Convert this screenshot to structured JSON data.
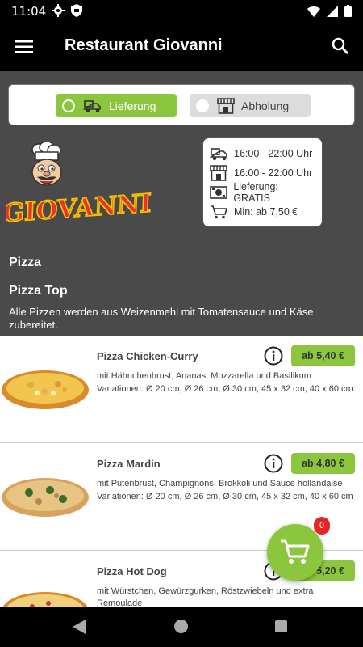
{
  "status": {
    "time": "11:04"
  },
  "app": {
    "title": "Restaurant Giovanni"
  },
  "mode": {
    "delivery_label": "Lieferung",
    "pickup_label": "Abholung"
  },
  "logo": {
    "text": "GIOVANNI"
  },
  "info": {
    "delivery_hours": "16:00 - 22:00 Uhr",
    "pickup_hours": "16:00 - 22:00 Uhr",
    "delivery_fee": "Lieferung: GRATIS",
    "min_order": "Min: ab 7,50 €"
  },
  "category": {
    "title": "Pizza",
    "subtitle": "Pizza Top",
    "description": "Alle Pizzen werden aus Weizenmehl mit Tomatensauce und Käse zubereitet."
  },
  "products": [
    {
      "name": "Pizza Chicken-Curry",
      "price": "ab 5,40 €",
      "desc": "mit Hähnchenbrust, Ananas, Mozzarella und Basilikum",
      "variations": "Variationen: Ø 20 cm, Ø 26 cm, Ø 30 cm, 45 x 32 cm, 40 x 60 cm"
    },
    {
      "name": "Pizza Mardin",
      "price": "ab 4,80 €",
      "desc": "mit Putenbrust, Champignons, Brokkoli und Sauce hollandaise",
      "variations": "Variationen: Ø 20 cm, Ø 26 cm, Ø 30 cm, 45 x 32 cm, 40 x 60 cm"
    },
    {
      "name": "Pizza Hot Dog",
      "price": "ab 5,20 €",
      "desc": "mit Würstchen, Gewürzgurken, Röstzwiebeln und extra Remoulade",
      "variations": ""
    }
  ],
  "cart": {
    "count": "0"
  },
  "colors": {
    "accent": "#8cc63f",
    "badge": "#e52424",
    "header": "#000000",
    "background": "#4a4a4a"
  }
}
